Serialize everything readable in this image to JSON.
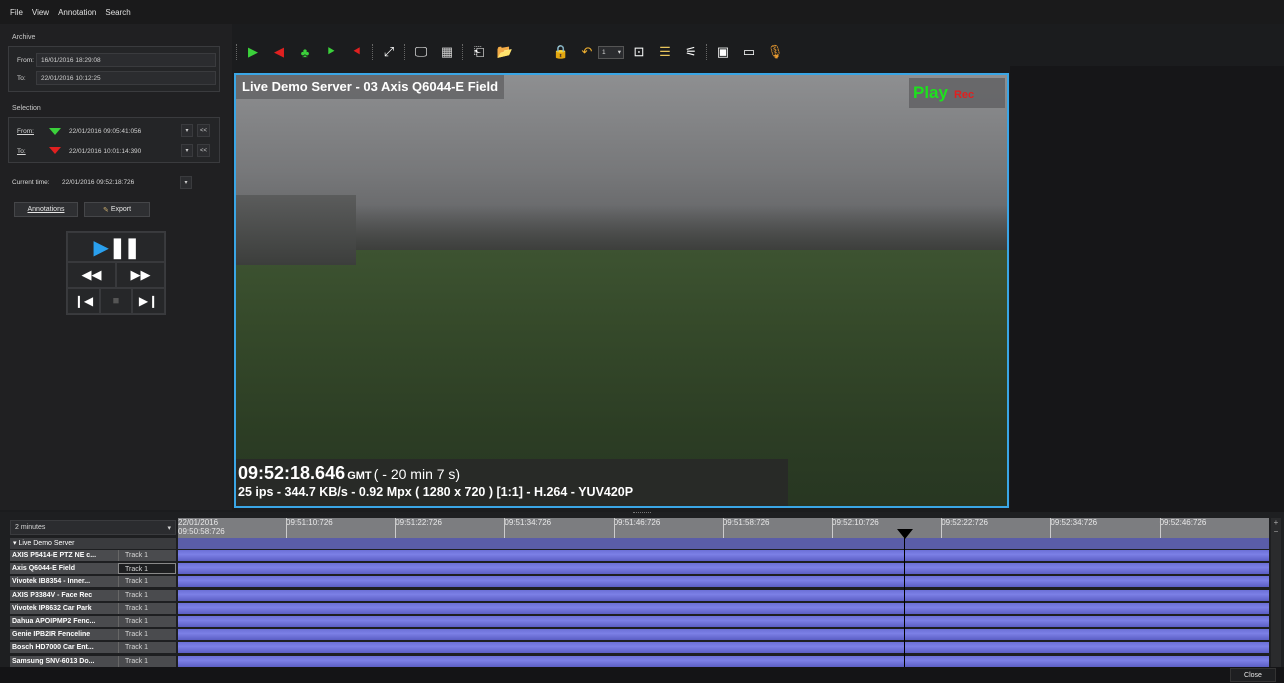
{
  "menu": {
    "file": "File",
    "view": "View",
    "annotation": "Annotation",
    "search": "Search"
  },
  "archive": {
    "title": "Archive",
    "from_label": "From:",
    "from_value": "16/01/2016 18:29:08",
    "to_label": "To:",
    "to_value": "22/01/2016 10:12:25"
  },
  "selection": {
    "title": "Selection",
    "from_label": "From:",
    "from_value": "22/01/2016 09:05:41:056",
    "to_label": "To:",
    "to_value": "22/01/2016 10:01:14:390",
    "rewind_label": "<<"
  },
  "current_time": {
    "label": "Current time:",
    "value": "22/01/2016 09:52:18:726"
  },
  "buttons": {
    "annotations": "Annotations",
    "export": "Export",
    "close": "Close"
  },
  "toolbar": {
    "stream_select": "1"
  },
  "video": {
    "title": "Live Demo Server - 03 Axis Q6044-E Field",
    "play": "Play",
    "rec": "Rec",
    "time": "09:52:18.646",
    "tz": "GMT",
    "offset": "( - 20 min 7 s)",
    "stats": "25 ips  -  344.7 KB/s  -  0.92 Mpx  ( 1280 x 720 ) [1:1] -  H.264  -  YUV420P"
  },
  "timeline": {
    "scale": "2 minutes",
    "start_date": "22/01/2016",
    "start_time": "09:50:58:726",
    "ticks": [
      "09:51:10:726",
      "09:51:22:726",
      "09:51:34:726",
      "09:51:46:726",
      "09:51:58:726",
      "09:52:10:726",
      "09:52:22:726",
      "09:52:34:726",
      "09:52:46:726"
    ],
    "server": "Live Demo Server",
    "cameras": [
      {
        "name": "AXIS P5414-E PTZ NE c...",
        "track": "Track 1"
      },
      {
        "name": "Axis Q6044-E Field",
        "track": "Track 1"
      },
      {
        "name": "Vivotek IB8354 - Inner...",
        "track": "Track 1"
      },
      {
        "name": "AXIS P3384V - Face Rec",
        "track": "Track 1"
      },
      {
        "name": "Vivotek IP8632 Car Park",
        "track": "Track 1"
      },
      {
        "name": "Dahua APOIPMP2 Fenc...",
        "track": "Track 1"
      },
      {
        "name": "Genie IPB2IR Fenceline",
        "track": "Track 1"
      },
      {
        "name": "Bosch HD7000 Car Ent...",
        "track": "Track 1"
      },
      {
        "name": "Samsung SNV-6013 Do...",
        "track": "Track 1"
      }
    ]
  },
  "colors": {
    "accent": "#3aa6e6",
    "play": "#1ee01e",
    "rec": "#e02020",
    "track": "#7074dc"
  }
}
